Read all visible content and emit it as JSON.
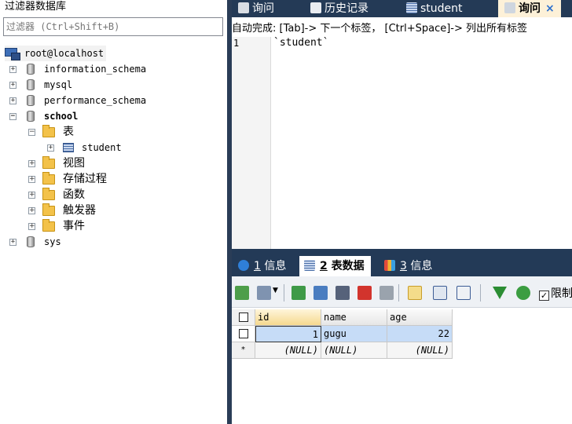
{
  "left": {
    "title": "过滤器数据库",
    "filter_placeholder": "过滤器 (Ctrl+Shift+B)",
    "tree": {
      "server": "root@localhost",
      "databases": [
        "information_schema",
        "mysql",
        "performance_schema"
      ],
      "school": "school",
      "tables_folder": "表",
      "table": "student",
      "folders": [
        "视图",
        "存储过程",
        "函数",
        "触发器",
        "事件"
      ],
      "sys": "sys"
    }
  },
  "tabs": [
    {
      "label": "询问",
      "icon": "query-icon"
    },
    {
      "label": "历史记录",
      "icon": "history-icon"
    },
    {
      "label": "student",
      "icon": "table-icon"
    },
    {
      "label": "询问",
      "icon": "query-icon",
      "close": "×"
    }
  ],
  "editor": {
    "hint": "自动完成: [Tab]-> 下一个标签， [Ctrl+Space]-> 列出所有标签",
    "line_number": "1",
    "code": "`student`"
  },
  "result_tabs": [
    {
      "num": "1",
      "label": "信息"
    },
    {
      "num": "2",
      "label": "表数据"
    },
    {
      "num": "3",
      "label": "信息"
    }
  ],
  "toolbar": {
    "limit_label": "限制"
  },
  "grid": {
    "columns": [
      "id",
      "name",
      "age"
    ],
    "rows": [
      [
        "1",
        "gugu",
        "22"
      ],
      [
        "(NULL)",
        "(NULL)",
        "(NULL)"
      ]
    ],
    "new_row_marker": "*"
  }
}
